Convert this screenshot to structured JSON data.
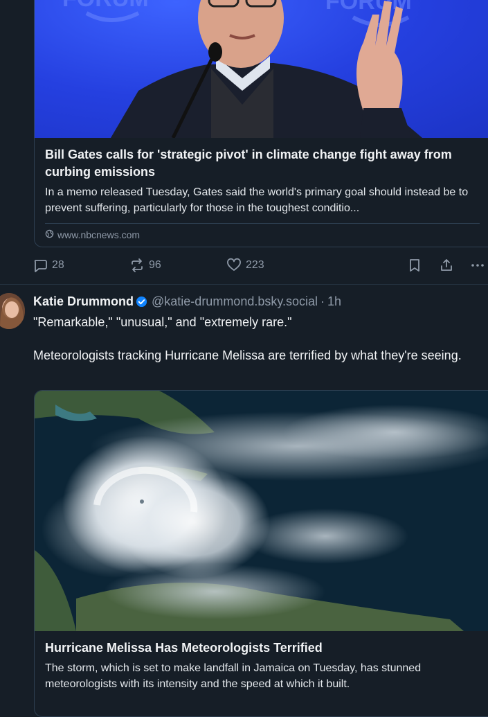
{
  "post1": {
    "link_card": {
      "title": "Bill Gates calls for 'strategic pivot' in climate change fight away from curbing emissions",
      "description": "In a memo released Tuesday, Gates said the world's primary goal should instead be to prevent suffering, particularly for those in the toughest conditio...",
      "domain": "www.nbcnews.com",
      "image_banner_text": "FORUM"
    },
    "actions": {
      "replies": "28",
      "reposts": "96",
      "likes": "223"
    }
  },
  "post2": {
    "author_name": "Katie Drummond",
    "handle": "@katie-drummond.bsky.social",
    "timestamp": "1h",
    "text_lines": [
      "\"Remarkable,\" \"unusual,\" and \"extremely rare.\"",
      "Meteorologists tracking Hurricane Melissa are terrified by what they're seeing."
    ],
    "link_card": {
      "title": "Hurricane Melissa Has Meteorologists Terrified",
      "description": "The storm, which is set to make landfall in Jamaica on Tuesday, has stunned meteorologists with its intensity and the speed at which it built."
    }
  },
  "colors": {
    "background": "#161e27",
    "border": "#2e4052",
    "muted_text": "#8f9aa8",
    "verified_badge": "#1083fe"
  },
  "icons": [
    "globe-icon",
    "reply-icon",
    "repost-icon",
    "heart-icon",
    "bookmark-icon",
    "share-icon",
    "more-icon",
    "verified-badge-icon"
  ]
}
